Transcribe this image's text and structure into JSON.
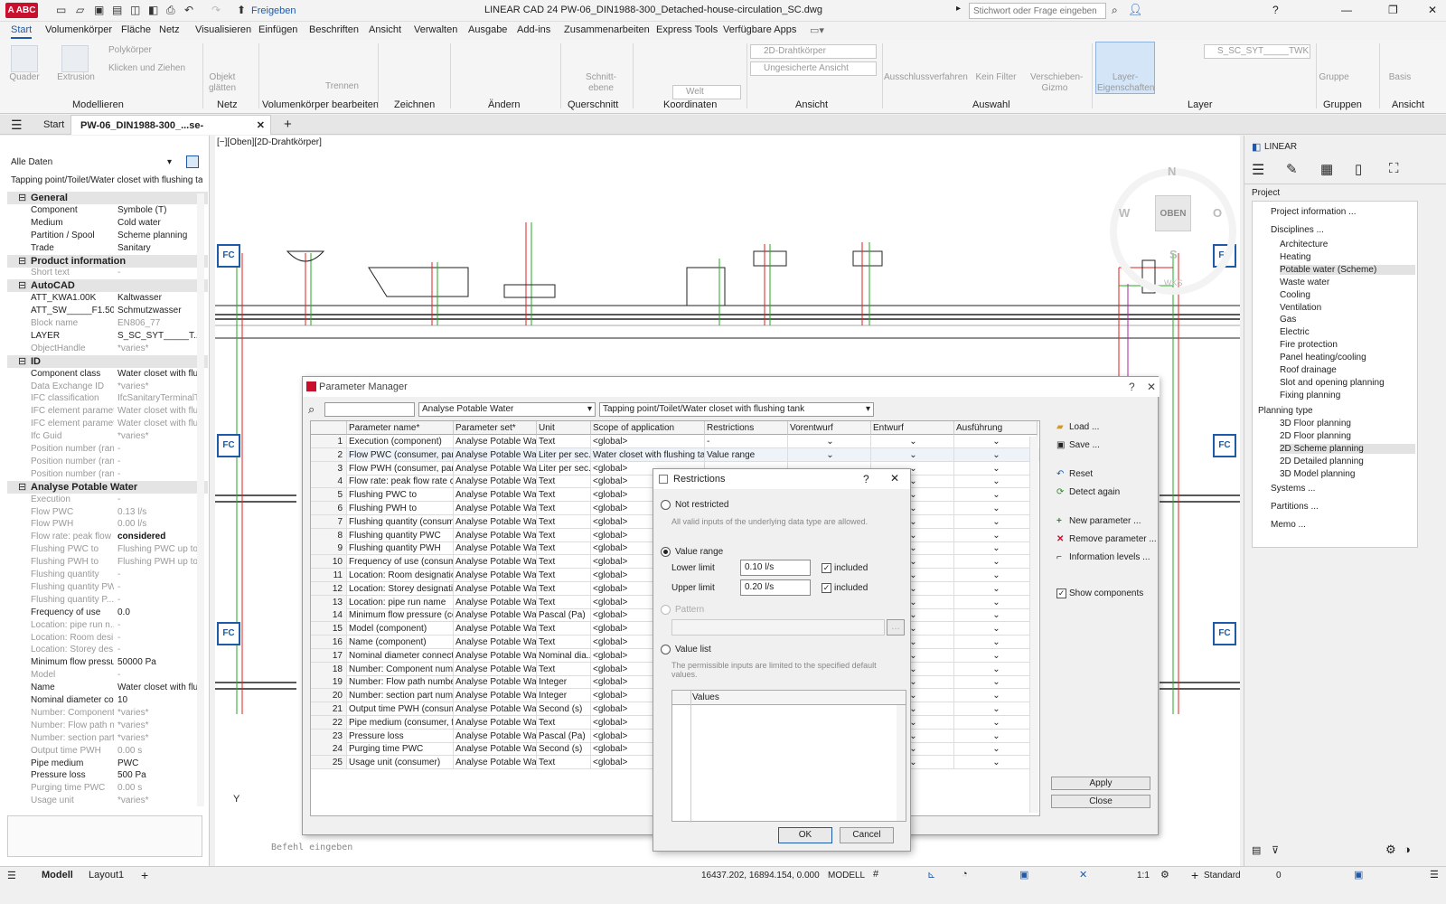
{
  "app": {
    "logo": "A ABC",
    "title": "LINEAR CAD 24   PW-06_DIN1988-300_Detached-house-circulation_SC.dwg",
    "share": "Freigeben",
    "search_placeholder": "Stichwort oder Frage eingeben"
  },
  "ribbon_tabs": [
    "Start",
    "Volumenkörper",
    "Fläche",
    "Netz",
    "Visualisieren",
    "Einfügen",
    "Beschriften",
    "Ansicht",
    "Verwalten",
    "Ausgabe",
    "Add-ins",
    "Zusammenarbeiten",
    "Express Tools",
    "Verfügbare Apps"
  ],
  "ribbon": {
    "groups": [
      "Modellieren",
      "Netz",
      "Volumenkörper bearbeiten",
      "Zeichnen",
      "Ändern",
      "Querschnitt",
      "Koordinaten",
      "Ansicht",
      "Auswahl",
      "Layer",
      "Gruppen",
      "Ansicht"
    ],
    "buttons": {
      "quader": "Quader",
      "extrusion": "Extrusion",
      "polykoerper": "Polykörper",
      "klicken": "Klicken und Ziehen",
      "objekt": "Objekt glätten",
      "trennen": "Trennen",
      "schnitt": "Schnitt-ebene",
      "ausschluss": "Ausschlussverfahren",
      "keinfilter": "Kein Filter",
      "verschieben": "Verschieben-Gizmo",
      "layereig": "Layer-Eigenschaften",
      "gruppe": "Gruppe",
      "basis": "Basis"
    },
    "combo_visual": "2D-Drahtkörper",
    "combo_view": "Ungesicherte Ansicht",
    "combo_world": "Welt",
    "combo_layer": "S_SC_SYT_____TWK"
  },
  "doc_tabs": {
    "start": "Start",
    "active": "PW-06_DIN1988-300_...se-cirkulation_SC*"
  },
  "left_panel": {
    "filter": "Alle Daten",
    "selection": "Tapping point/Toilet/Water closet with flushing tan",
    "rows": [
      {
        "cat": "General"
      },
      {
        "k": "Component",
        "v": "Symbole (T)"
      },
      {
        "k": "Medium",
        "v": "Cold water"
      },
      {
        "k": "Partition / Spool",
        "v": "Scheme planning"
      },
      {
        "k": "Trade",
        "v": "Sanitary"
      },
      {
        "cat": "Product information"
      },
      {
        "k": "Short text",
        "v": "-",
        "g": true
      },
      {
        "cat": "AutoCAD"
      },
      {
        "k": "ATT_KWA1.00K",
        "v": "Kaltwasser"
      },
      {
        "k": "ATT_SW_____F1.50",
        "v": "Schmutzwasser"
      },
      {
        "k": "Block name",
        "v": "EN806_77",
        "g": true
      },
      {
        "k": "LAYER",
        "v": "S_SC_SYT_____T..."
      },
      {
        "k": "ObjectHandle",
        "v": "*varies*",
        "g": true
      },
      {
        "cat": "ID"
      },
      {
        "k": "Component class",
        "v": "Water closet with flu..."
      },
      {
        "k": "Data Exchange ID",
        "v": "*varies*",
        "g": true
      },
      {
        "k": "IFC classification",
        "v": "IfcSanitaryTerminalT...",
        "g": true
      },
      {
        "k": "IFC element paramet...",
        "v": "Water closet with flu...",
        "g": true
      },
      {
        "k": "IFC element paramet...",
        "v": "Water closet with flu...",
        "g": true
      },
      {
        "k": "Ifc Guid",
        "v": "*varies*",
        "g": true
      },
      {
        "k": "Position number (ran...",
        "v": "-",
        "g": true
      },
      {
        "k": "Position number (ran...",
        "v": "-",
        "g": true
      },
      {
        "k": "Position number (ran...",
        "v": "-",
        "g": true
      },
      {
        "cat": "Analyse Potable Water"
      },
      {
        "k": "Execution",
        "v": "-",
        "g": true
      },
      {
        "k": "Flow PWC",
        "v": "0.13 l/s",
        "g": true
      },
      {
        "k": "Flow PWH",
        "v": "0.00 l/s",
        "g": true
      },
      {
        "k": "Flow rate: peak flow ...",
        "v": "considered",
        "g": true,
        "b": true
      },
      {
        "k": "Flushing PWC to",
        "v": "Flushing PWC up to",
        "g": true
      },
      {
        "k": "Flushing PWH to",
        "v": "Flushing PWH up to",
        "g": true
      },
      {
        "k": "Flushing quantity",
        "v": "-",
        "g": true
      },
      {
        "k": "Flushing quantity PWC",
        "v": "-",
        "g": true
      },
      {
        "k": "Flushing quantity P...",
        "v": "-",
        "g": true
      },
      {
        "k": "Frequency of use",
        "v": "0.0"
      },
      {
        "k": "Location: pipe run n...",
        "v": "-",
        "g": true
      },
      {
        "k": "Location: Room desi...",
        "v": "-",
        "g": true
      },
      {
        "k": "Location: Storey des...",
        "v": "-",
        "g": true
      },
      {
        "k": "Minimum flow pressure",
        "v": "50000 Pa"
      },
      {
        "k": "Model",
        "v": "-",
        "g": true
      },
      {
        "k": "Name",
        "v": "Water closet with flu..."
      },
      {
        "k": "Nominal diameter co...",
        "v": "10"
      },
      {
        "k": "Number: Component...",
        "v": "*varies*",
        "g": true
      },
      {
        "k": "Number: Flow path n...",
        "v": "*varies*",
        "g": true
      },
      {
        "k": "Number: section part...",
        "v": "*varies*",
        "g": true
      },
      {
        "k": "Output time PWH",
        "v": "0.00 s",
        "g": true
      },
      {
        "k": "Pipe medium",
        "v": "PWC"
      },
      {
        "k": "Pressure loss",
        "v": "500 Pa"
      },
      {
        "k": "Purging time PWC",
        "v": "0.00 s",
        "g": true
      },
      {
        "k": "Usage unit",
        "v": "*varies*",
        "g": true
      }
    ]
  },
  "viewport": {
    "label": "[−][Oben][2D-Drahtkörper]",
    "compass": {
      "n": "N",
      "s": "S",
      "w": "W",
      "o": "O",
      "center": "OBEN",
      "wcs": "WKS"
    },
    "fc": "FC",
    "axis_y": "Y"
  },
  "right_panel": {
    "header": "LINEAR",
    "project": "Project",
    "project_info": "Project information ...",
    "disciplines": "Disciplines ...",
    "discipline_items": [
      "Architecture",
      "Heating",
      "Potable water (Scheme)",
      "Waste water",
      "Cooling",
      "Ventilation",
      "Gas",
      "Electric",
      "Fire protection",
      "Panel heating/cooling",
      "Roof drainage",
      "Slot and opening planning",
      "Fixing planning"
    ],
    "planning_type": "Planning type",
    "planning_items": [
      "3D Floor planning",
      "2D Floor planning",
      "2D Scheme planning",
      "2D Detailed planning",
      "3D Model planning"
    ],
    "systems": "Systems ...",
    "partitions": "Partitions ...",
    "memo": "Memo ..."
  },
  "param_manager": {
    "title": "Parameter Manager",
    "filter_set": "Analyse Potable Water",
    "filter_component": "Tapping point/Toilet/Water closet with flushing tank",
    "columns": [
      "Parameter name*",
      "Parameter set*",
      "Unit",
      "Scope of application",
      "Restrictions",
      "Vorentwurf",
      "Entwurf",
      "Ausführung"
    ],
    "rows": [
      [
        "1",
        "Execution (component)",
        "Analyse Potable Water",
        "Text",
        "<global>",
        "-"
      ],
      [
        "2",
        "Flow PWC (consumer, partia...",
        "Analyse Potable Water",
        "Liter per sec...",
        "Water closet with flushing tank,...",
        "Value range"
      ],
      [
        "3",
        "Flow PWH (consumer, parti...",
        "Analyse Potable Water",
        "Liter per sec...",
        "<global>",
        ""
      ],
      [
        "4",
        "Flow rate: peak flow rate co...",
        "Analyse Potable Water",
        "Text",
        "<global>",
        ""
      ],
      [
        "5",
        "Flushing PWC to",
        "Analyse Potable Water",
        "Text",
        "<global>",
        ""
      ],
      [
        "6",
        "Flushing PWH to",
        "Analyse Potable Water",
        "Text",
        "<global>",
        ""
      ],
      [
        "7",
        "Flushing quantity (consumer)",
        "Analyse Potable Water",
        "Text",
        "<global>",
        ""
      ],
      [
        "8",
        "Flushing quantity PWC",
        "Analyse Potable Water",
        "Text",
        "<global>",
        ""
      ],
      [
        "9",
        "Flushing quantity PWH",
        "Analyse Potable Water",
        "Text",
        "<global>",
        ""
      ],
      [
        "10",
        "Frequency of use (consumer)",
        "Analyse Potable Water",
        "Text",
        "<global>",
        ""
      ],
      [
        "11",
        "Location: Room designation",
        "Analyse Potable Water",
        "Text",
        "<global>",
        ""
      ],
      [
        "12",
        "Location: Storey designation",
        "Analyse Potable Water",
        "Text",
        "<global>",
        ""
      ],
      [
        "13",
        "Location: pipe run name",
        "Analyse Potable Water",
        "Text",
        "<global>",
        ""
      ],
      [
        "14",
        "Minimum flow pressure (con...",
        "Analyse Potable Water",
        "Pascal (Pa)",
        "<global>",
        ""
      ],
      [
        "15",
        "Model (component)",
        "Analyse Potable Water",
        "Text",
        "<global>",
        ""
      ],
      [
        "16",
        "Name (component)",
        "Analyse Potable Water",
        "Text",
        "<global>",
        ""
      ],
      [
        "17",
        "Nominal diameter connectio...",
        "Analyse Potable Water",
        "Nominal dia...",
        "<global>",
        ""
      ],
      [
        "18",
        "Number: Component number",
        "Analyse Potable Water",
        "Text",
        "<global>",
        ""
      ],
      [
        "19",
        "Number: Flow path number",
        "Analyse Potable Water",
        "Integer",
        "<global>",
        ""
      ],
      [
        "20",
        "Number: section part number",
        "Analyse Potable Water",
        "Integer",
        "<global>",
        ""
      ],
      [
        "21",
        "Output time PWH (consumer)",
        "Analyse Potable Water",
        "Second (s)",
        "<global>",
        ""
      ],
      [
        "22",
        "Pipe medium (consumer, fitti...",
        "Analyse Potable Water",
        "Text",
        "<global>",
        ""
      ],
      [
        "23",
        "Pressure loss",
        "Analyse Potable Water",
        "Pascal (Pa)",
        "<global>",
        ""
      ],
      [
        "24",
        "Purging time PWC",
        "Analyse Potable Water",
        "Second (s)",
        "<global>",
        ""
      ],
      [
        "25",
        "Usage unit (consumer)",
        "Analyse Potable Water",
        "Text",
        "<global>",
        ""
      ]
    ],
    "side": {
      "load": "Load ...",
      "save": "Save ...",
      "reset": "Reset",
      "detect": "Detect again",
      "new": "New parameter ...",
      "remove": "Remove parameter ...",
      "info": "Information levels ...",
      "show": "Show components",
      "apply": "Apply",
      "close": "Close"
    }
  },
  "restrictions": {
    "title": "Restrictions",
    "help": "?",
    "not_restricted": "Not restricted",
    "not_restricted_hint": "All valid inputs of the underlying data type are allowed.",
    "value_range": "Value range",
    "lower_label": "Lower limit",
    "lower_value": "0.10 l/s",
    "upper_label": "Upper limit",
    "upper_value": "0.20 l/s",
    "included": "included",
    "pattern": "Pattern",
    "value_list": "Value list",
    "value_list_hint": "The permissible inputs are limited to the specified default values.",
    "values_header": "Values",
    "ok": "OK",
    "cancel": "Cancel"
  },
  "statusbar": {
    "model": "Modell",
    "layout": "Layout1",
    "coords": "16437.202, 16894.154, 0.000",
    "mode": "MODELL",
    "scale": "1:1",
    "standard": "Standard",
    "zero": "0"
  },
  "command": "Befehl eingeben"
}
